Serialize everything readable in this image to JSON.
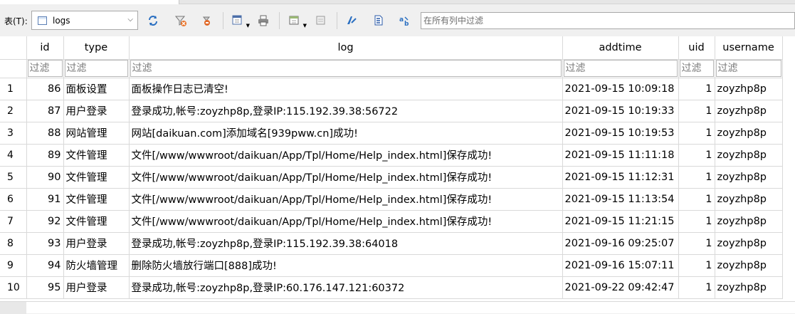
{
  "toolbar": {
    "table_label": "表(T):",
    "table_select_value": "logs",
    "filter_placeholder": "在所有列中过滤",
    "icons": [
      "refresh-icon",
      "clear-filter-icon",
      "save-filter-icon",
      "insert-record-icon",
      "print-icon",
      "delete-record-icon",
      "undo-icon",
      "edit-icon",
      "filter-icon",
      "find-replace-icon"
    ]
  },
  "columns": [
    "id",
    "type",
    "log",
    "addtime",
    "uid",
    "username"
  ],
  "filter_text": "过滤",
  "rows": [
    {
      "rownum": "1",
      "id": "86",
      "type": "面板设置",
      "log": "面板操作日志已清空!",
      "addtime": "2021-09-15 10:09:18",
      "uid": "1",
      "username": "zoyzhp8p"
    },
    {
      "rownum": "2",
      "id": "87",
      "type": "用户登录",
      "log": "登录成功,帐号:zoyzhp8p,登录IP:115.192.39.38:56722",
      "addtime": "2021-09-15 10:19:33",
      "uid": "1",
      "username": "zoyzhp8p"
    },
    {
      "rownum": "3",
      "id": "88",
      "type": "网站管理",
      "log": "网站[daikuan.com]添加域名[939pww.cn]成功!",
      "addtime": "2021-09-15 10:19:53",
      "uid": "1",
      "username": "zoyzhp8p"
    },
    {
      "rownum": "4",
      "id": "89",
      "type": "文件管理",
      "log": "文件[/www/wwwroot/daikuan/App/Tpl/Home/Help_index.html]保存成功!",
      "addtime": "2021-09-15 11:11:18",
      "uid": "1",
      "username": "zoyzhp8p"
    },
    {
      "rownum": "5",
      "id": "90",
      "type": "文件管理",
      "log": "文件[/www/wwwroot/daikuan/App/Tpl/Home/Help_index.html]保存成功!",
      "addtime": "2021-09-15 11:12:31",
      "uid": "1",
      "username": "zoyzhp8p"
    },
    {
      "rownum": "6",
      "id": "91",
      "type": "文件管理",
      "log": "文件[/www/wwwroot/daikuan/App/Tpl/Home/Help_index.html]保存成功!",
      "addtime": "2021-09-15 11:13:54",
      "uid": "1",
      "username": "zoyzhp8p"
    },
    {
      "rownum": "7",
      "id": "92",
      "type": "文件管理",
      "log": "文件[/www/wwwroot/daikuan/App/Tpl/Home/Help_index.html]保存成功!",
      "addtime": "2021-09-15 11:21:15",
      "uid": "1",
      "username": "zoyzhp8p"
    },
    {
      "rownum": "8",
      "id": "93",
      "type": "用户登录",
      "log": "登录成功,帐号:zoyzhp8p,登录IP:115.192.39.38:64018",
      "addtime": "2021-09-16 09:25:07",
      "uid": "1",
      "username": "zoyzhp8p"
    },
    {
      "rownum": "9",
      "id": "94",
      "type": "防火墙管理",
      "log": "删除防火墙放行端口[888]成功!",
      "addtime": "2021-09-16 15:07:11",
      "uid": "1",
      "username": "zoyzhp8p"
    },
    {
      "rownum": "10",
      "id": "95",
      "type": "用户登录",
      "log": "登录成功,帐号:zoyzhp8p,登录IP:60.176.147.121:60372",
      "addtime": "2021-09-22 09:42:47",
      "uid": "1",
      "username": "zoyzhp8p"
    }
  ]
}
